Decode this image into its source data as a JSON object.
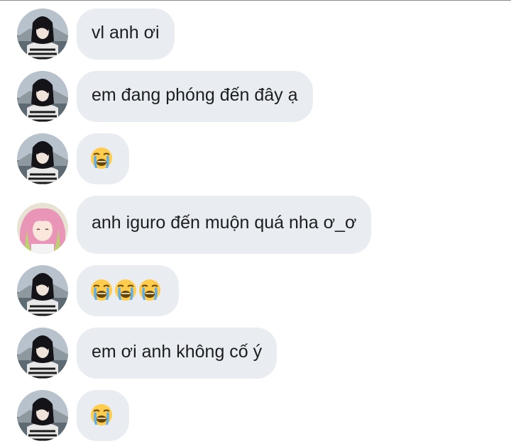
{
  "messages": [
    {
      "sender": "iguro",
      "kind": "text",
      "text": "vl anh ơi"
    },
    {
      "sender": "iguro",
      "kind": "text",
      "text": "em đang phóng đến đây ạ"
    },
    {
      "sender": "iguro",
      "kind": "emoji",
      "emoji_icon": "loudly-crying-face-icon",
      "count": 1
    },
    {
      "sender": "mitsuri",
      "kind": "text",
      "text": "anh iguro đến muộn quá nha ơ_ơ"
    },
    {
      "sender": "iguro",
      "kind": "emoji",
      "emoji_icon": "loudly-crying-face-icon",
      "count": 3
    },
    {
      "sender": "iguro",
      "kind": "text",
      "text": "em ơi anh không cố ý"
    },
    {
      "sender": "iguro",
      "kind": "emoji",
      "emoji_icon": "loudly-crying-face-icon",
      "count": 1
    }
  ],
  "colors": {
    "bubble_bg": "#e9ecf0",
    "text": "#1c1e21",
    "divider": "#8a8a8a"
  }
}
